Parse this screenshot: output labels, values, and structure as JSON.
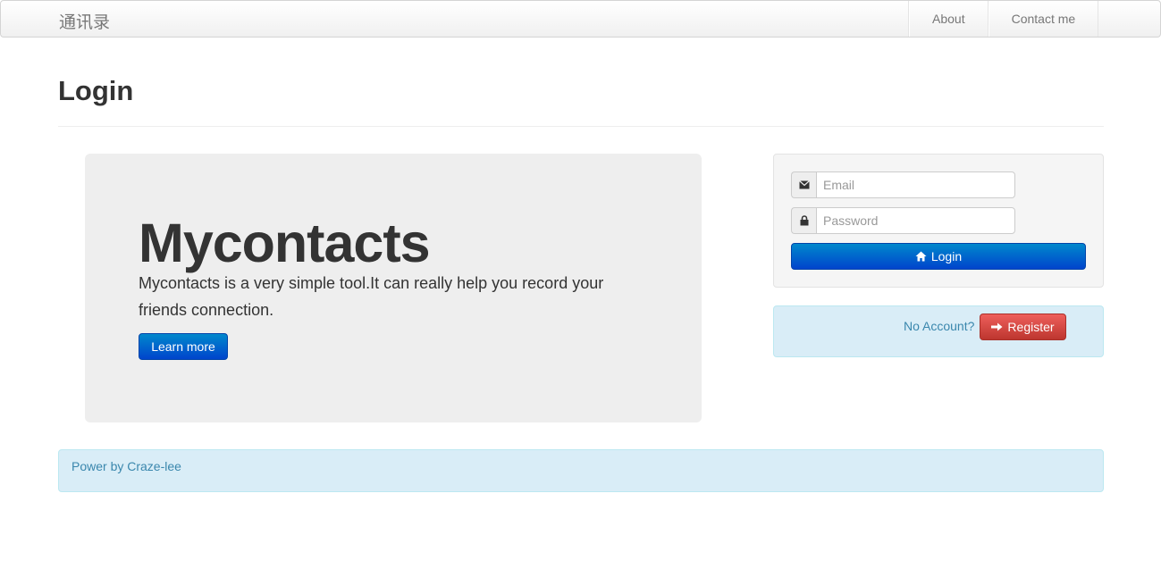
{
  "navbar": {
    "brand": "通讯录",
    "items": [
      {
        "label": "About"
      },
      {
        "label": "Contact me"
      }
    ]
  },
  "page": {
    "title": "Login"
  },
  "hero": {
    "title": "Mycontacts",
    "text": "Mycontacts is a very simple tool.It can really help you record your friends connection.",
    "button_label": "Learn more"
  },
  "login_form": {
    "email": {
      "placeholder": "Email",
      "value": "",
      "icon": "envelope-icon"
    },
    "password": {
      "placeholder": "Password",
      "value": "",
      "icon": "lock-icon"
    },
    "submit_label": "Login",
    "submit_icon": "home-icon"
  },
  "register": {
    "prompt": "No Account?",
    "button_label": "Register",
    "button_icon": "arrow-right-icon"
  },
  "footer": {
    "text": "Power by Craze-lee"
  },
  "colors": {
    "primary": "#0055cc",
    "danger": "#da4f49",
    "info_bg": "#d9edf7",
    "info_text": "#3a87ad"
  }
}
